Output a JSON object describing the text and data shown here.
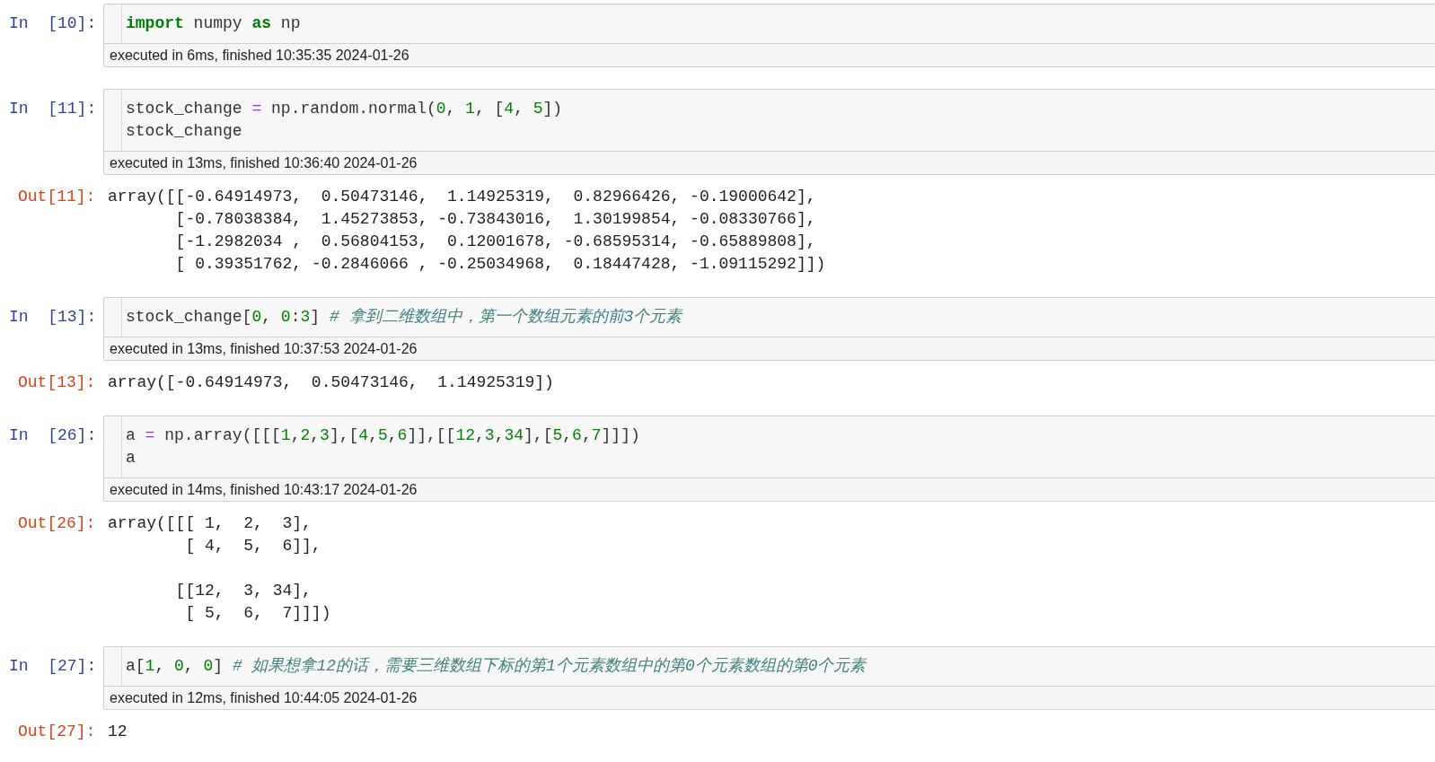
{
  "cells": [
    {
      "in_prompt": "In  [10]:",
      "code": [
        [
          {
            "kind": "keyword",
            "text": "import"
          },
          {
            "kind": "plain",
            "text": " numpy "
          },
          {
            "kind": "keyword",
            "text": "as"
          },
          {
            "kind": "plain",
            "text": " np"
          }
        ]
      ],
      "timing": "executed in 6ms, finished 10:35:35 2024-01-26"
    },
    {
      "in_prompt": "In  [11]:",
      "code": [
        [
          {
            "kind": "plain",
            "text": "stock_change "
          },
          {
            "kind": "operator",
            "text": "="
          },
          {
            "kind": "plain",
            "text": " np.random.normal("
          },
          {
            "kind": "number",
            "text": "0"
          },
          {
            "kind": "plain",
            "text": ", "
          },
          {
            "kind": "number",
            "text": "1"
          },
          {
            "kind": "plain",
            "text": ", ["
          },
          {
            "kind": "number",
            "text": "4"
          },
          {
            "kind": "plain",
            "text": ", "
          },
          {
            "kind": "number",
            "text": "5"
          },
          {
            "kind": "plain",
            "text": "])"
          }
        ],
        [
          {
            "kind": "plain",
            "text": "stock_change"
          }
        ]
      ],
      "timing": "executed in 13ms, finished 10:36:40 2024-01-26",
      "out_prompt": "Out[11]:",
      "output": [
        [
          "array([[-0.64914973,  0.50473146,  1.14925319,  0.82966426, -0.19000642],",
          "       [-0.78038384,  1.45273853, -0.73843016,  1.30199854, -0.08330766],",
          "       [-1.2982034 ,  0.56804153,  0.12001678, -0.68595314, -0.65889808],",
          "       [ 0.39351762, -0.2846066 , -0.25034968,  0.18447428, -1.09115292]])"
        ]
      ]
    },
    {
      "in_prompt": "In  [13]:",
      "code": [
        [
          {
            "kind": "plain",
            "text": "stock_change["
          },
          {
            "kind": "number",
            "text": "0"
          },
          {
            "kind": "plain",
            "text": ", "
          },
          {
            "kind": "number",
            "text": "0"
          },
          {
            "kind": "plain",
            "text": ":"
          },
          {
            "kind": "number",
            "text": "3"
          },
          {
            "kind": "plain",
            "text": "] "
          },
          {
            "kind": "comment",
            "text": "# 拿到二维数组中，第一个数组元素的前3个元素"
          }
        ]
      ],
      "timing": "executed in 13ms, finished 10:37:53 2024-01-26",
      "out_prompt": "Out[13]:",
      "output": [
        [
          "array([-0.64914973,  0.50473146,  1.14925319])"
        ]
      ]
    },
    {
      "in_prompt": "In  [26]:",
      "code": [
        [
          {
            "kind": "plain",
            "text": "a "
          },
          {
            "kind": "operator",
            "text": "="
          },
          {
            "kind": "plain",
            "text": " np.array([[["
          },
          {
            "kind": "number",
            "text": "1"
          },
          {
            "kind": "plain",
            "text": ","
          },
          {
            "kind": "number",
            "text": "2"
          },
          {
            "kind": "plain",
            "text": ","
          },
          {
            "kind": "number",
            "text": "3"
          },
          {
            "kind": "plain",
            "text": "],["
          },
          {
            "kind": "number",
            "text": "4"
          },
          {
            "kind": "plain",
            "text": ","
          },
          {
            "kind": "number",
            "text": "5"
          },
          {
            "kind": "plain",
            "text": ","
          },
          {
            "kind": "number",
            "text": "6"
          },
          {
            "kind": "plain",
            "text": "]],[["
          },
          {
            "kind": "number",
            "text": "12"
          },
          {
            "kind": "plain",
            "text": ","
          },
          {
            "kind": "number",
            "text": "3"
          },
          {
            "kind": "plain",
            "text": ","
          },
          {
            "kind": "number",
            "text": "34"
          },
          {
            "kind": "plain",
            "text": "],["
          },
          {
            "kind": "number",
            "text": "5"
          },
          {
            "kind": "plain",
            "text": ","
          },
          {
            "kind": "number",
            "text": "6"
          },
          {
            "kind": "plain",
            "text": ","
          },
          {
            "kind": "number",
            "text": "7"
          },
          {
            "kind": "plain",
            "text": "]]])"
          }
        ],
        [
          {
            "kind": "plain",
            "text": "a"
          }
        ]
      ],
      "timing": "executed in 14ms, finished 10:43:17 2024-01-26",
      "out_prompt": "Out[26]:",
      "output": [
        [
          "array([[[ 1,  2,  3],",
          "        [ 4,  5,  6]],"
        ],
        [
          "       [[12,  3, 34],",
          "        [ 5,  6,  7]]])"
        ]
      ]
    },
    {
      "in_prompt": "In  [27]:",
      "code": [
        [
          {
            "kind": "plain",
            "text": "a["
          },
          {
            "kind": "number",
            "text": "1"
          },
          {
            "kind": "plain",
            "text": ", "
          },
          {
            "kind": "number",
            "text": "0"
          },
          {
            "kind": "plain",
            "text": ", "
          },
          {
            "kind": "number",
            "text": "0"
          },
          {
            "kind": "plain",
            "text": "] "
          },
          {
            "kind": "comment",
            "text": "# 如果想拿12的话，需要三维数组下标的第1个元素数组中的第0个元素数组的第0个元素"
          }
        ]
      ],
      "timing": "executed in 12ms, finished 10:44:05 2024-01-26",
      "out_prompt": "Out[27]:",
      "output": [
        [
          "12"
        ]
      ]
    }
  ]
}
